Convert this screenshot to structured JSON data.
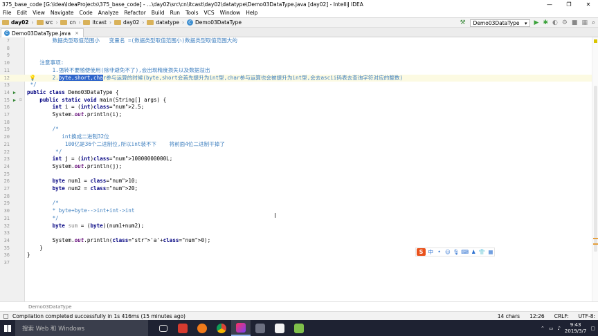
{
  "window": {
    "title": "375_base_code [G:\\idea\\IdeaProjects\\375_base_code] - ...\\day02\\src\\cn\\itcast\\day02\\datatype\\Demo03DataType.java [day02] - IntelliJ IDEA",
    "minimize": "—",
    "maximize": "❐",
    "close": "✕"
  },
  "menu": [
    "File",
    "Edit",
    "View",
    "Navigate",
    "Code",
    "Analyze",
    "Refactor",
    "Build",
    "Run",
    "Tools",
    "VCS",
    "Window",
    "Help"
  ],
  "breadcrumb": {
    "items": [
      "day02",
      "src",
      "cn",
      "itcast",
      "day02",
      "datatype",
      "Demo03DataType"
    ]
  },
  "toolbar": {
    "run_config": "Demo03DataType",
    "icons": [
      "hammer-icon",
      "run-icon",
      "debug-icon",
      "coverage-icon",
      "profile-icon",
      "stop-icon",
      "project-structure-icon",
      "search-everywhere-icon"
    ]
  },
  "editor_tab": {
    "label": "Demo03DataType.java",
    "close": "×"
  },
  "code": {
    "lines": [
      {
        "n": "7",
        "t": "        数据类型取值范围小   变量名 =(数据类型取值范围小)数据类型取值范围大的"
      },
      {
        "n": "8",
        "t": ""
      },
      {
        "n": "9",
        "t": ""
      },
      {
        "n": "10",
        "t": "    注意事项:"
      },
      {
        "n": "11",
        "t": "        1.强转不要随便使用(除非避免不了),会出现精度损失以及数据溢出"
      },
      {
        "n": "12",
        "t": "        2.byte,short,char参与运算的时候(byte,short会首先提升为int型,char参与运算也会被提升为int型,会去ascii码表去查询字符对应的整数)"
      },
      {
        "n": "13",
        "t": " */"
      },
      {
        "n": "14",
        "t": "public class Demo03DataType {"
      },
      {
        "n": "15",
        "t": "    public static void main(String[] args) {"
      },
      {
        "n": "16",
        "t": "        int i = (int)2.5;"
      },
      {
        "n": "17",
        "t": "        System.out.println(i);"
      },
      {
        "n": "18",
        "t": ""
      },
      {
        "n": "19",
        "t": "        /*"
      },
      {
        "n": "20",
        "t": "           int换成二进制32位"
      },
      {
        "n": "21",
        "t": "            100亿是36个二进制位,所以int装不下    将前面4位二进制干掉了"
      },
      {
        "n": "22",
        "t": "         */"
      },
      {
        "n": "23",
        "t": "        int j = (int)10000000000L;"
      },
      {
        "n": "24",
        "t": "        System.out.println(j);"
      },
      {
        "n": "25",
        "t": ""
      },
      {
        "n": "26",
        "t": "        byte num1 = 10;"
      },
      {
        "n": "27",
        "t": "        byte num2 = 20;"
      },
      {
        "n": "28",
        "t": ""
      },
      {
        "n": "29",
        "t": "        /*"
      },
      {
        "n": "30",
        "t": "        * byte+byte-->int+int->int"
      },
      {
        "n": "31",
        "t": "        */"
      },
      {
        "n": "32",
        "t": "        byte sum = (byte)(num1+num2);"
      },
      {
        "n": "33",
        "t": ""
      },
      {
        "n": "34",
        "t": "        System.out.println('a'+0);"
      },
      {
        "n": "35",
        "t": "    }"
      },
      {
        "n": "36",
        "t": "}"
      },
      {
        "n": "37",
        "t": ""
      }
    ]
  },
  "ime_toolbar": {
    "logo": "S",
    "items": [
      "中",
      "•",
      "☺",
      "🎙",
      "⌨",
      "♟",
      "👕",
      "▦"
    ]
  },
  "nav_crumb": "Demo03DataType",
  "status": {
    "message": "Compilation completed successfully in 1s 416ms (15 minutes ago)",
    "chars": "14 chars",
    "position": "12:26",
    "line_sep": "CRLF:",
    "encoding": "UTF-8:"
  },
  "taskbar": {
    "search_placeholder": "搜索 Web 和 Windows",
    "time": "9:43",
    "date": "2019/3/7"
  },
  "colors": {
    "keyword": "#000080",
    "comment": "#3e7fbf",
    "number": "#0000ff",
    "selection": "#2f65ca",
    "taskbar": "#1e2232"
  }
}
